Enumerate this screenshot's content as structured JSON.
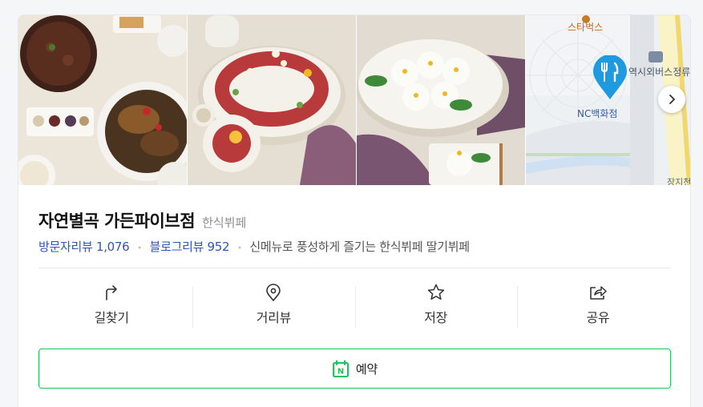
{
  "gallery": {
    "map": {
      "poi_starbucks": "스타벅스",
      "poi_bus_stop": "역시외버스정류",
      "poi_dept_store": "NC백화점",
      "corner_label": "장지천"
    }
  },
  "place": {
    "name": "자연별곡 가든파이브점",
    "category": "한식뷔페",
    "visitor_review_label": "방문자리뷰 1,076",
    "blog_review_label": "블로그리뷰 952",
    "tagline": "신메뉴로 풍성하게 즐기는 한식뷔페 딸기뷔페"
  },
  "actions": [
    {
      "label": "길찾기",
      "icon": "directions-icon"
    },
    {
      "label": "거리뷰",
      "icon": "location-pin-icon"
    },
    {
      "label": "저장",
      "icon": "star-icon"
    },
    {
      "label": "공유",
      "icon": "share-icon"
    }
  ],
  "reserve": {
    "label": "예약",
    "icon_letter": "N",
    "icon": "naver-calendar-icon"
  },
  "colors": {
    "link": "#2f54bc",
    "naver_green": "#19c65a",
    "map_pin": "#1e9be0"
  }
}
